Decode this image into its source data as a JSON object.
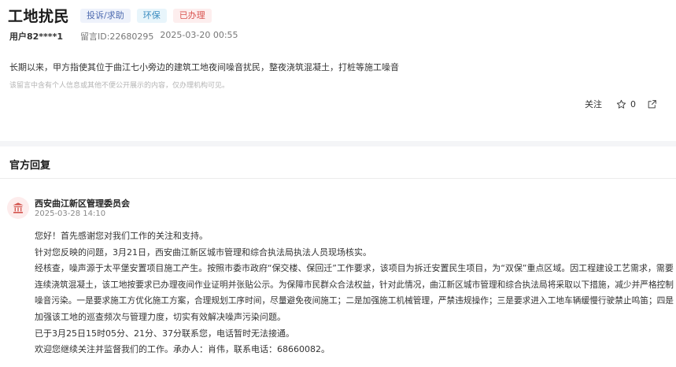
{
  "post": {
    "title": "工地扰民",
    "tags": [
      "投诉/求助",
      "环保",
      "已办理"
    ],
    "user": "用户82****1",
    "message_id": "留言ID:22680295",
    "datetime": "2025-03-20 00:55",
    "content": "长期以来，甲方指使其位于曲江七小旁边的建筑工地夜间噪音扰民，整夜浇筑混凝土，打桩等施工噪音",
    "privacy_note": "该留言中含有个人信息或其他不便公开展示的内容，仅办理机构可见。",
    "actions": {
      "follow_label": "关注",
      "like_count": "0"
    }
  },
  "reply": {
    "header": "官方回复",
    "org_name": "西安曲江新区管理委员会",
    "time": "2025-03-28 14:10",
    "lines": [
      "您好！首先感谢您对我们工作的关注和支持。",
      "针对您反映的问题，3月21日，西安曲江新区城市管理和综合执法局执法人员现场核实。",
      "经核查，噪声源于太平堡安置项目施工产生。按照市委市政府“保交楼、保回迁”工作要求，该项目为拆迁安置民生项目，为“双保”重点区域。因工程建设工艺需求，需要",
      "连续浇筑混凝土，该工地按要求已办理夜间作业证明并张贴公示。为保障市民群众合法权益，针对此情况，曲江新区城市管理和综合执法局将采取以下措施，减少并严格控制",
      "噪音污染。一是要求施工方优化施工方案，合理规划工序时间，尽量避免夜间施工；二是加强施工机械管理，严禁违规操作；三是要求进入工地车辆缓慢行驶禁止鸣笛；四是",
      "加强该工地的巡查频次与管理力度，切实有效解决噪声污染问题。",
      "已于3月25日15时05分、21分、37分联系您，电话暂时无法接通。",
      "欢迎您继续关注并监督我们的工作。承办人：肖伟，联系电话：68660082。"
    ]
  }
}
